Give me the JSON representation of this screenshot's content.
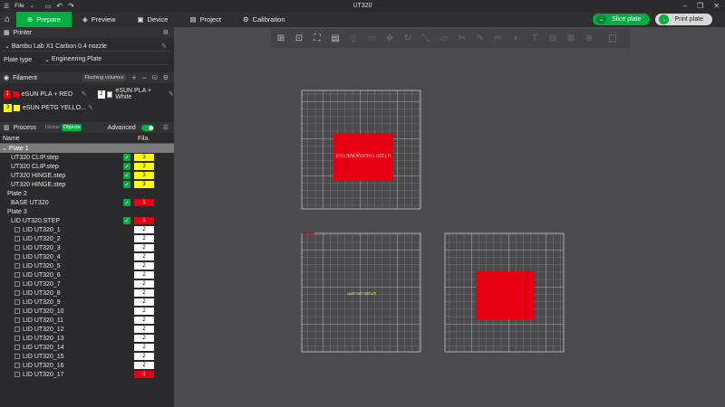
{
  "titlebar": {
    "menu": "File",
    "title": "UT320"
  },
  "nav": {
    "tabs": [
      {
        "label": "Prepare"
      },
      {
        "label": "Preview"
      },
      {
        "label": "Device"
      },
      {
        "label": "Project"
      },
      {
        "label": "Calibration"
      }
    ],
    "slice_label": "Slice plate",
    "print_label": "Print plate"
  },
  "printer": {
    "section_title": "Printer",
    "printer_name": "Bambu Lab X1 Carbon 0.4 nozzle",
    "plate_type_label": "Plate type",
    "plate_type_value": "Engineering Plate"
  },
  "filament": {
    "section_title": "Filament",
    "flushing_label": "Flushing volumes",
    "items": [
      {
        "num": "1",
        "name": "eSUN PLA + RED",
        "color": "#e60012"
      },
      {
        "num": "2",
        "name": "eSUN PLA + White",
        "color": "#ffffff"
      },
      {
        "num": "3",
        "name": "eSUN PETG YELLO...",
        "color": "#ffff00"
      }
    ]
  },
  "process": {
    "section_title": "Process",
    "global_label": "Global",
    "objects_label": "Objects",
    "advanced_label": "Advanced"
  },
  "objects": {
    "col_name": "Name",
    "col_fila": "Fila.",
    "rows": [
      {
        "type": "plate",
        "name": "Plate 1",
        "fila": "",
        "color": ""
      },
      {
        "type": "obj",
        "name": "UT320 CLIP.step",
        "fila": "3",
        "color": "#ffff00"
      },
      {
        "type": "obj",
        "name": "UT320 CLIP.step",
        "fila": "3",
        "color": "#ffff00"
      },
      {
        "type": "obj",
        "name": "UT320 HINGE.step",
        "fila": "3",
        "color": "#ffff00"
      },
      {
        "type": "obj",
        "name": "UT320 HINGE.step",
        "fila": "3",
        "color": "#ffff00"
      },
      {
        "type": "plate2",
        "name": "Plate 2",
        "fila": "",
        "color": ""
      },
      {
        "type": "obj",
        "name": "BASE UT320",
        "fila": "1",
        "color": "#e60012"
      },
      {
        "type": "plate2",
        "name": "Plate 3",
        "fila": "",
        "color": ""
      },
      {
        "type": "obj",
        "name": "LID UT320.STEP",
        "fila": "1",
        "color": "#e60012"
      },
      {
        "type": "sub",
        "name": "LID UT320_1",
        "fila": "2",
        "color": "#ffffff"
      },
      {
        "type": "sub",
        "name": "LID UT320_2",
        "fila": "2",
        "color": "#ffffff"
      },
      {
        "type": "sub",
        "name": "LID UT320_3",
        "fila": "2",
        "color": "#ffffff"
      },
      {
        "type": "sub",
        "name": "LID UT320_4",
        "fila": "2",
        "color": "#ffffff"
      },
      {
        "type": "sub",
        "name": "LID UT320_5",
        "fila": "2",
        "color": "#ffffff"
      },
      {
        "type": "sub",
        "name": "LID UT320_6",
        "fila": "2",
        "color": "#ffffff"
      },
      {
        "type": "sub",
        "name": "LID UT320_7",
        "fila": "2",
        "color": "#ffffff"
      },
      {
        "type": "sub",
        "name": "LID UT320_8",
        "fila": "2",
        "color": "#ffffff"
      },
      {
        "type": "sub",
        "name": "LID UT320_9",
        "fila": "2",
        "color": "#ffffff"
      },
      {
        "type": "sub",
        "name": "LID UT320_10",
        "fila": "2",
        "color": "#ffffff"
      },
      {
        "type": "sub",
        "name": "LID UT320_11",
        "fila": "2",
        "color": "#ffffff"
      },
      {
        "type": "sub",
        "name": "LID UT320_12",
        "fila": "2",
        "color": "#ffffff"
      },
      {
        "type": "sub",
        "name": "LID UT320_13",
        "fila": "2",
        "color": "#ffffff"
      },
      {
        "type": "sub",
        "name": "LID UT320_14",
        "fila": "2",
        "color": "#ffffff"
      },
      {
        "type": "sub",
        "name": "LID UT320_15",
        "fila": "2",
        "color": "#ffffff"
      },
      {
        "type": "sub",
        "name": "LID UT320_16",
        "fila": "2",
        "color": "#ffffff"
      },
      {
        "type": "sub",
        "name": "LID UT320_17",
        "fila": "1",
        "color": "#e60012"
      }
    ]
  },
  "viewport": {
    "plate1_text": "UT320 THERMOMETER",
    "plate2_text": "UT320 ON OFF"
  },
  "colors": {
    "accent": "#00ae42",
    "red": "#e60012",
    "yellow": "#ffff00"
  }
}
